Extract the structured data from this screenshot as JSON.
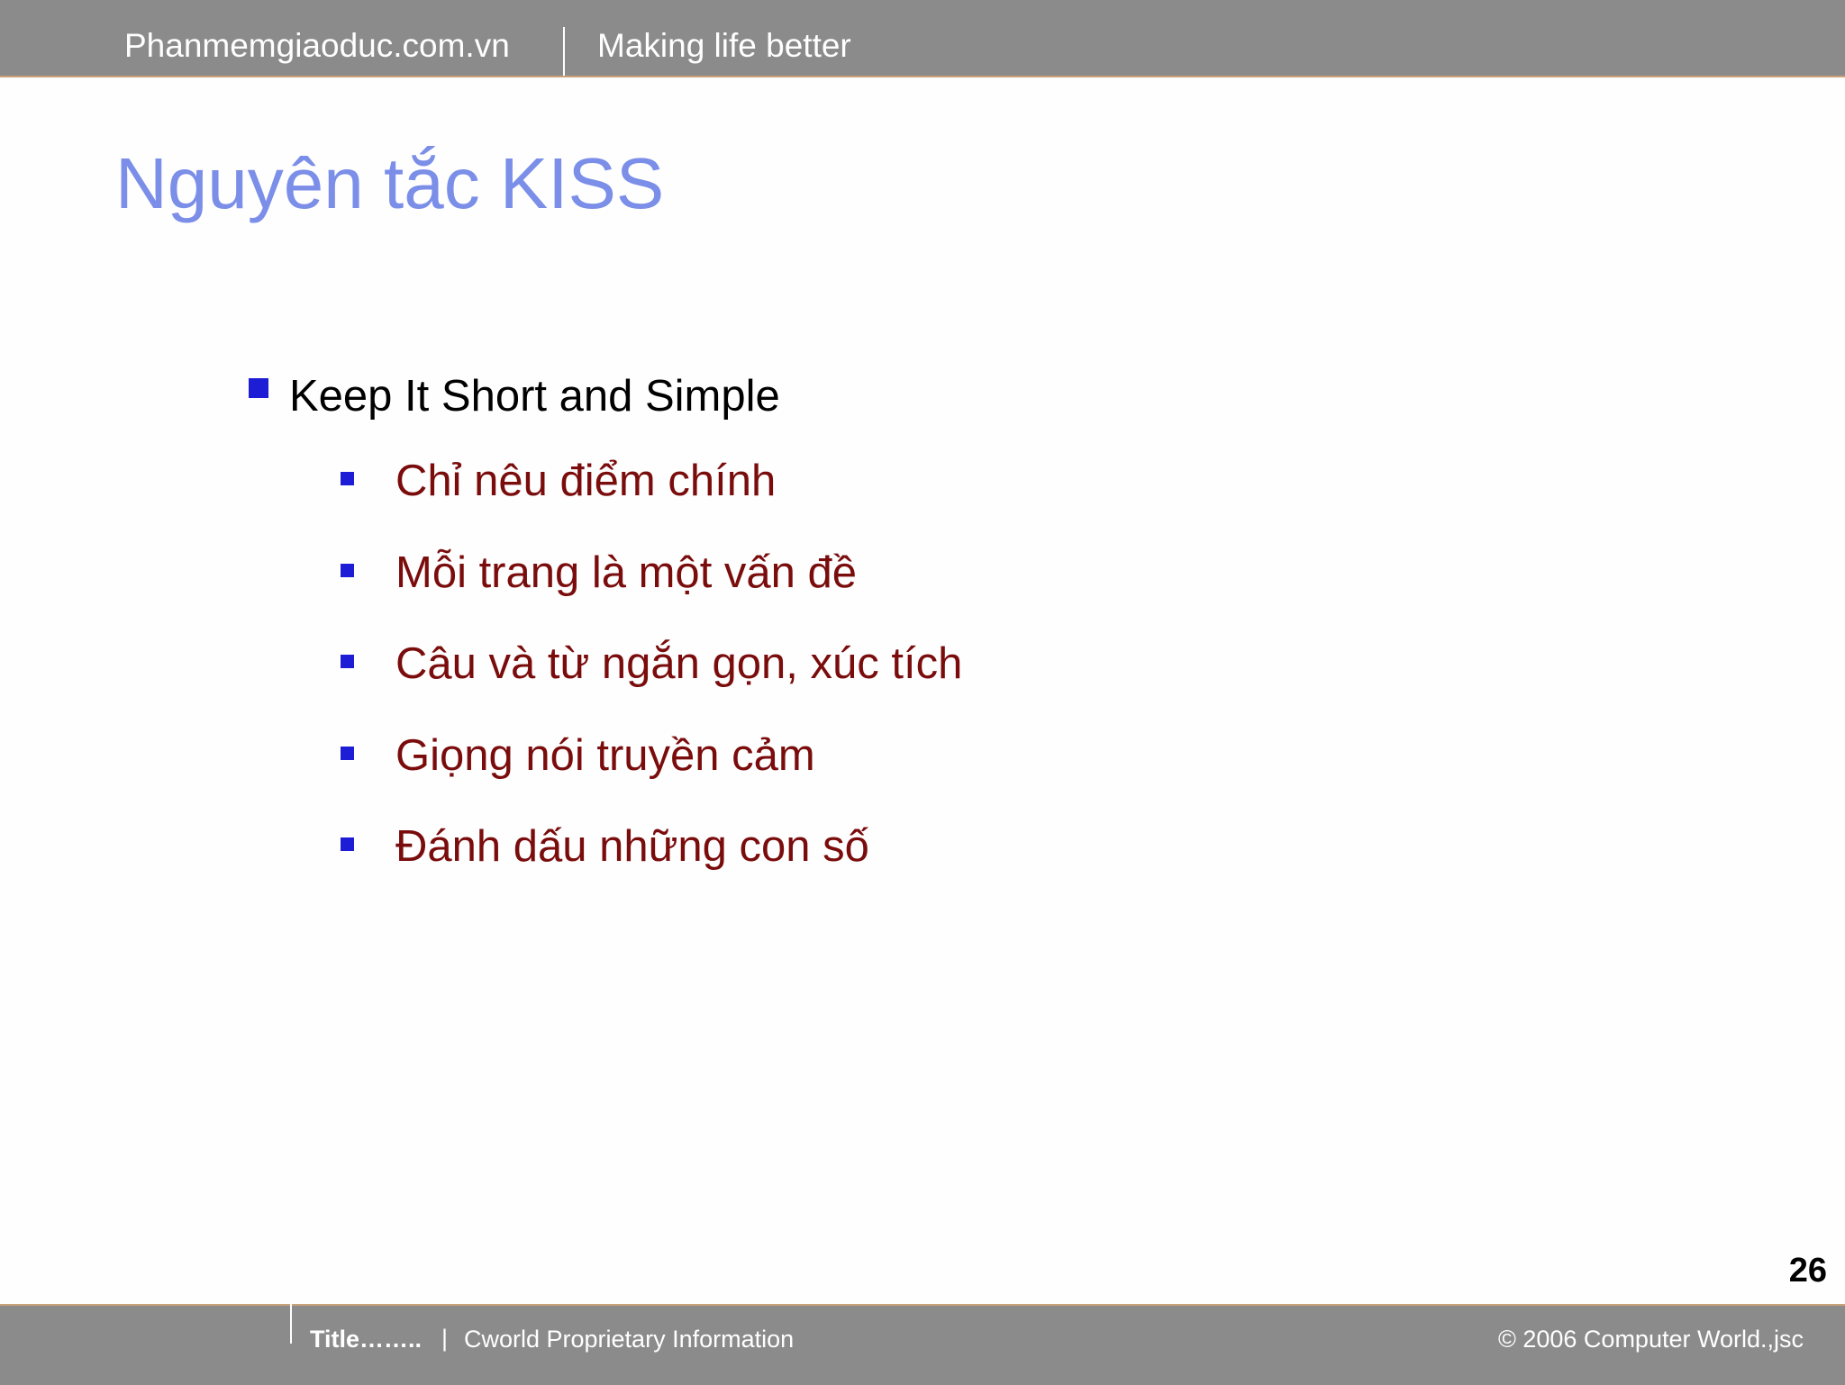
{
  "header": {
    "site": "Phanmemgiaoduc.com.vn",
    "tagline": "Making life better"
  },
  "slide": {
    "title": "Nguyên tắc KISS",
    "bullet": "Keep It Short and Simple",
    "sub_bullets": [
      "Chỉ nêu điểm chính",
      "Mỗi trang là một vấn đề",
      "Câu và từ ngắn gọn, xúc tích",
      "Giọng nói truyền cảm",
      "Đánh dấu những con số"
    ],
    "page_number": "26"
  },
  "footer": {
    "title": "Title……..",
    "separator": "|",
    "info": "Cworld Proprietary Information",
    "copyright": "© 2006 Computer World.,jsc"
  },
  "colors": {
    "bar": "#8b8b8b",
    "title": "#7b8ee8",
    "sub_text": "#7a0c0c",
    "bullet_marker": "#1d1dd6"
  }
}
